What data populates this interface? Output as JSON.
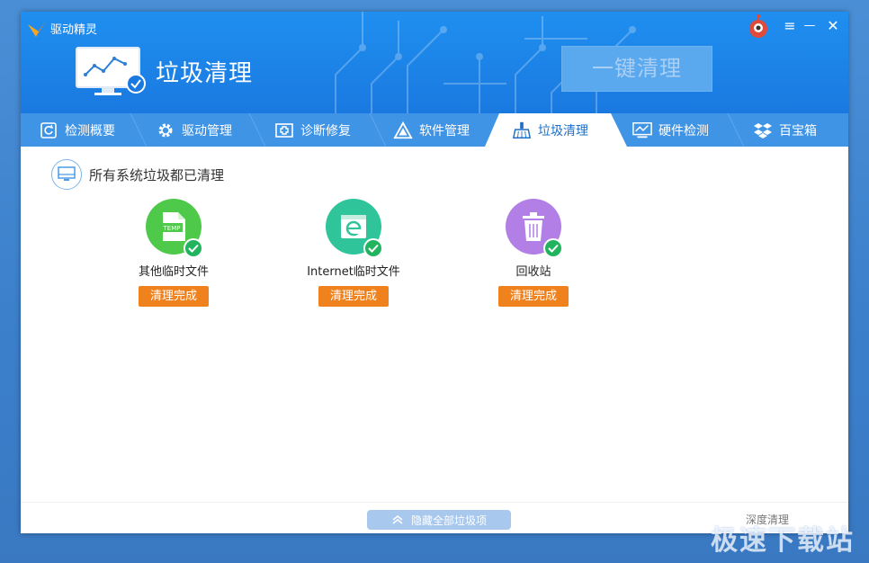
{
  "app": {
    "title": "驱动精灵"
  },
  "header": {
    "section_title": "垃圾清理",
    "one_key_button": "一键清理"
  },
  "window_controls": {
    "menu": "≡",
    "minimize": "—",
    "close": "✕"
  },
  "tabs": [
    {
      "label": "检测概要",
      "icon": "refresh-icon"
    },
    {
      "label": "驱动管理",
      "icon": "gear-icon"
    },
    {
      "label": "诊断修复",
      "icon": "first-aid-icon"
    },
    {
      "label": "软件管理",
      "icon": "software-triangle-icon"
    },
    {
      "label": "垃圾清理",
      "icon": "broom-icon",
      "active": true
    },
    {
      "label": "硬件检测",
      "icon": "hardware-monitor-icon"
    },
    {
      "label": "百宝箱",
      "icon": "toolbox-icon"
    }
  ],
  "status": {
    "text": "所有系统垃圾都已清理"
  },
  "items": [
    {
      "label": "其他临时文件",
      "status": "清理完成",
      "icon": "temp-file-icon",
      "color": "#4fc94a",
      "badge": "TEMP"
    },
    {
      "label": "Internet临时文件",
      "status": "清理完成",
      "icon": "internet-explorer-icon",
      "color": "#2fc49a"
    },
    {
      "label": "回收站",
      "status": "清理完成",
      "icon": "recycle-bin-icon",
      "color": "#b27fe6"
    }
  ],
  "footer": {
    "hide_all": "隐藏全部垃圾项",
    "deep_clean": "深度清理"
  },
  "watermark": "极速下载站",
  "colors": {
    "header": "#1a79e0",
    "tab_bar": "#3f94e6",
    "done_button": "#f0821e",
    "check": "#22b35e"
  }
}
